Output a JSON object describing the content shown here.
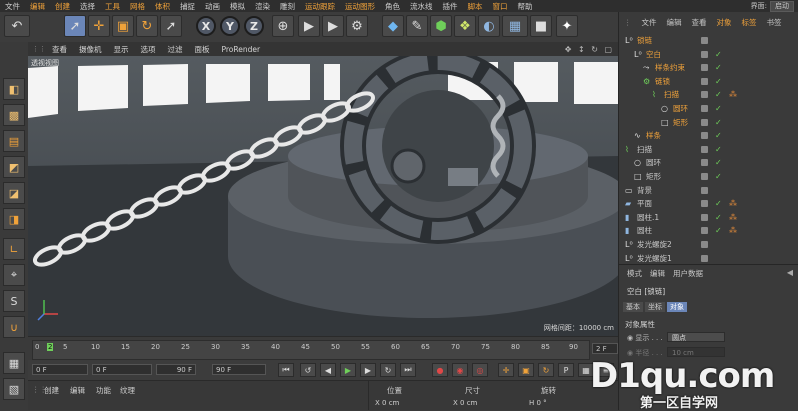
{
  "menubar": {
    "items": [
      "文件",
      "编辑",
      "创建",
      "选择",
      "工具",
      "网格",
      "体积",
      "捕捉",
      "动画",
      "模拟",
      "渲染",
      "雕刻",
      "运动跟踪",
      "运动图形",
      "角色",
      "流水线",
      "插件",
      "脚本",
      "窗口",
      "帮助"
    ],
    "layout_label": "界面:",
    "layout_value": "启动"
  },
  "toolbar": {
    "icons": [
      "undo-icon",
      "live-select-icon",
      "move-icon",
      "scale-icon",
      "rotate-icon",
      "last-tool-icon",
      "x-axis",
      "y-axis",
      "z-axis",
      "world-coords-icon",
      "render-view-icon",
      "render-picture-queue-icon",
      "edit-render-settings-icon",
      "cube-icon",
      "pen-spline-icon",
      "subdivision-icon",
      "array-icon",
      "deformer-icon",
      "floor-icon",
      "camera-icon",
      "light-icon"
    ],
    "axis_labels": {
      "x": "X",
      "y": "Y",
      "z": "Z"
    }
  },
  "viewport_menu": {
    "items": [
      "查看",
      "摄像机",
      "显示",
      "选项",
      "过滤",
      "面板",
      "ProRender"
    ]
  },
  "viewport": {
    "label": "透视视图",
    "grid_spacing": "网格间距：10000 cm"
  },
  "timeline": {
    "ticks": [
      "0",
      "5",
      "10",
      "15",
      "20",
      "25",
      "30",
      "35",
      "40",
      "45",
      "50",
      "55",
      "60",
      "65",
      "70",
      "75",
      "80",
      "85",
      "90"
    ],
    "current_frame_box": "2 F"
  },
  "transport": {
    "start_field": "0 F",
    "end_field": "90 F",
    "field_a": "0 F",
    "field_b": "90 F"
  },
  "bottom_tabs": [
    "创建",
    "编辑",
    "功能",
    "纹理"
  ],
  "coordinates": {
    "headers": [
      "位置",
      "尺寸",
      "旋转"
    ],
    "values": [
      "X  0 cm",
      "X  0 cm",
      "H  0 °"
    ]
  },
  "object_manager": {
    "tabs": [
      "文件",
      "编辑",
      "查看",
      "对象",
      "标签",
      "书签"
    ],
    "active_tab": "对象",
    "rows": [
      {
        "name": "锁链",
        "indent": 0,
        "selected": true,
        "icon": "null-icon",
        "check": false,
        "tag": false
      },
      {
        "name": "空白",
        "indent": 1,
        "selected": true,
        "icon": "null-icon",
        "check": true,
        "tag": false
      },
      {
        "name": "样条约束",
        "indent": 2,
        "selected": true,
        "icon": "spline-constraint-icon",
        "check": true,
        "tag": false
      },
      {
        "name": "链锁",
        "indent": 2,
        "selected": true,
        "icon": "cloner-icon",
        "check": true,
        "tag": false
      },
      {
        "name": "扫描",
        "indent": 3,
        "selected": true,
        "icon": "sweep-icon",
        "check": true,
        "tag": true
      },
      {
        "name": "圆环",
        "indent": 4,
        "selected": true,
        "icon": "circle-icon",
        "check": true,
        "tag": false
      },
      {
        "name": "矩形",
        "indent": 4,
        "selected": true,
        "icon": "rectangle-icon",
        "check": true,
        "tag": false
      },
      {
        "name": "样条",
        "indent": 1,
        "selected": true,
        "icon": "spline-icon",
        "check": true,
        "tag": false
      },
      {
        "name": "扫描",
        "indent": 0,
        "selected": false,
        "icon": "sweep-icon",
        "check": true,
        "tag": false
      },
      {
        "name": "圆环",
        "indent": 1,
        "selected": false,
        "icon": "circle-icon",
        "check": true,
        "tag": false
      },
      {
        "name": "矩形",
        "indent": 1,
        "selected": false,
        "icon": "rectangle-icon",
        "check": true,
        "tag": false
      },
      {
        "name": "背景",
        "indent": 0,
        "selected": false,
        "icon": "background-icon",
        "check": false,
        "tag": false
      },
      {
        "name": "平面",
        "indent": 0,
        "selected": false,
        "icon": "plane-icon",
        "check": true,
        "tag": true
      },
      {
        "name": "圆柱.1",
        "indent": 0,
        "selected": false,
        "icon": "cylinder-icon",
        "check": true,
        "tag": true
      },
      {
        "name": "圆柱",
        "indent": 0,
        "selected": false,
        "icon": "cylinder-icon",
        "check": true,
        "tag": true
      },
      {
        "name": "发光螺旋2",
        "indent": 0,
        "selected": false,
        "icon": "null-icon",
        "check": false,
        "tag": false
      },
      {
        "name": "发光螺旋1",
        "indent": 0,
        "selected": false,
        "icon": "null-icon",
        "check": false,
        "tag": false
      }
    ]
  },
  "attribute_manager": {
    "tabs": [
      "模式",
      "编辑",
      "用户数据"
    ],
    "title": "空白 [锁链]",
    "subtabs": [
      "基本",
      "坐标",
      "对象"
    ],
    "active_subtab": "对象",
    "section": "对象属性",
    "display_label": "显示",
    "display_value": "圆点",
    "radius_label": "半径",
    "radius_value": "10 cm"
  },
  "watermark": {
    "big": "D1qu.com",
    "small": "第一区自学网"
  },
  "colors": {
    "accent": "#f0a23a",
    "selected_tab": "#6b86b8",
    "check_green": "#6fcf5a"
  }
}
